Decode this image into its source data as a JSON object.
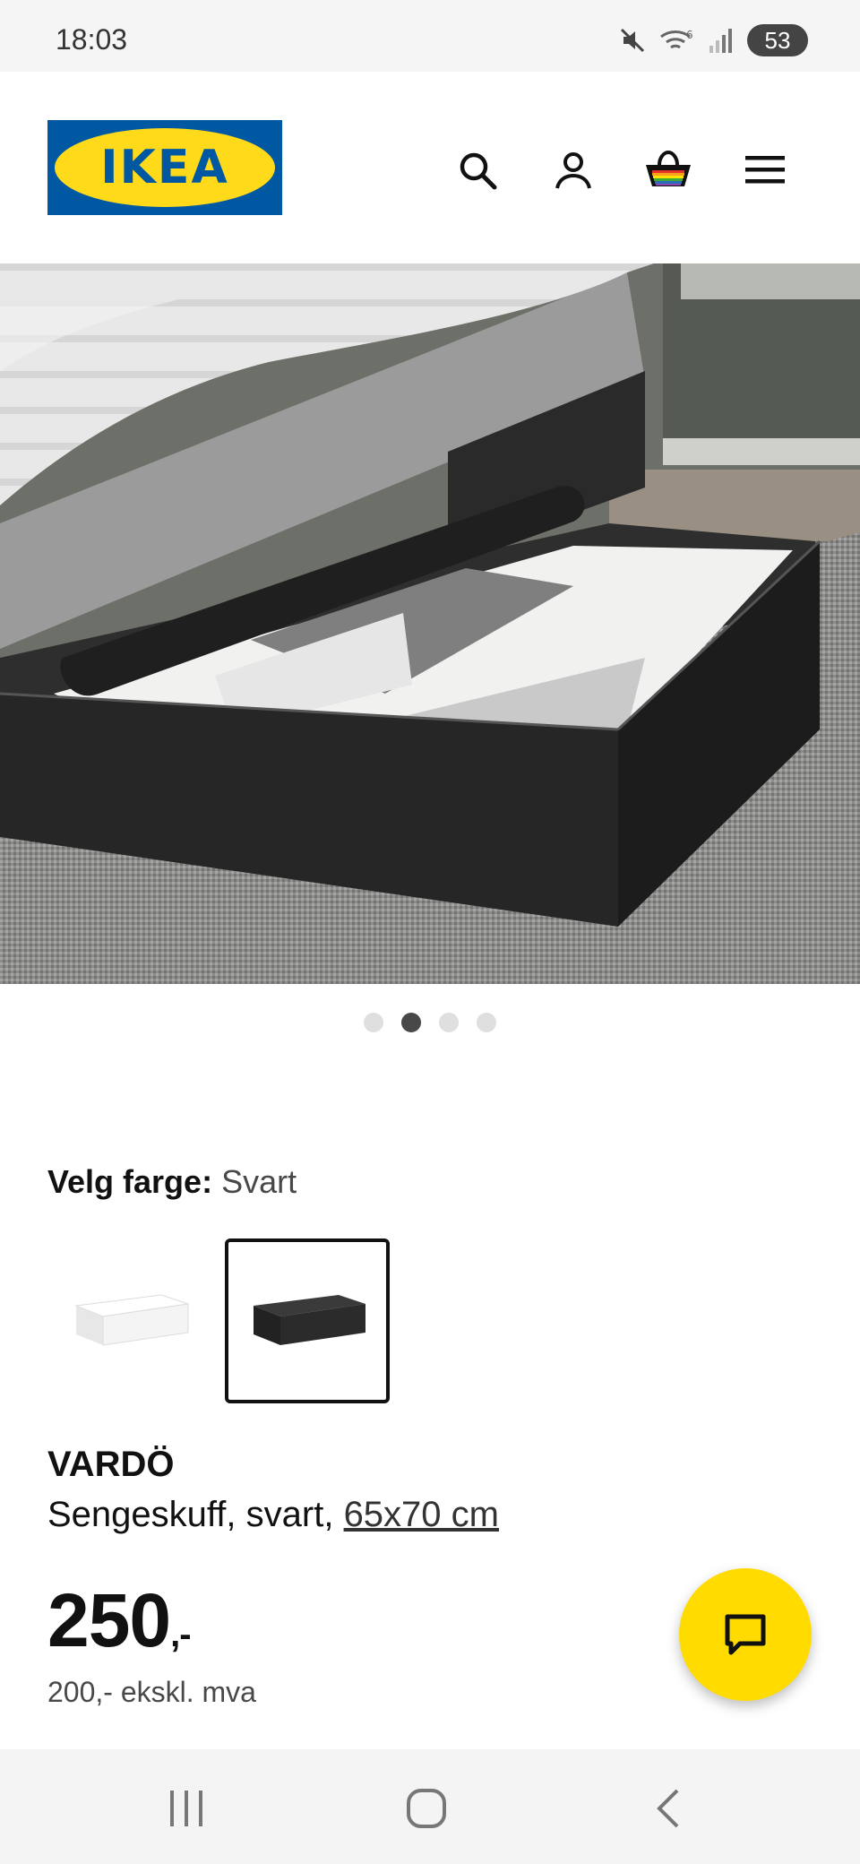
{
  "status_bar": {
    "time": "18:03",
    "battery": "53",
    "icons": [
      "mute-icon",
      "wifi-icon",
      "signal-icon",
      "battery-icon"
    ]
  },
  "header": {
    "logo_text": "IKEA",
    "logo_colors": {
      "background": "#0058a3",
      "oval": "#ffda1a"
    },
    "icons": [
      "search-icon",
      "account-icon",
      "basket-icon",
      "menu-icon"
    ]
  },
  "gallery": {
    "image_count": 4,
    "active_index": 1
  },
  "color_selector": {
    "label": "Velg farge:",
    "selected": "Svart",
    "options": [
      {
        "name": "white",
        "color": "#f2f2f2"
      },
      {
        "name": "black",
        "color": "#2b2b2b"
      }
    ]
  },
  "product": {
    "name": "VARDÖ",
    "description": "Sengeskuff, svart,",
    "size": "65x70 cm",
    "price": "250",
    "price_suffix": ",-",
    "price_excl_vat": "200,- ekskl. mva"
  },
  "chat_button": {
    "icon": "chat-icon",
    "color": "#ffdb00"
  },
  "nav_bar": {
    "icons": [
      "recents-icon",
      "home-icon",
      "back-icon"
    ]
  }
}
